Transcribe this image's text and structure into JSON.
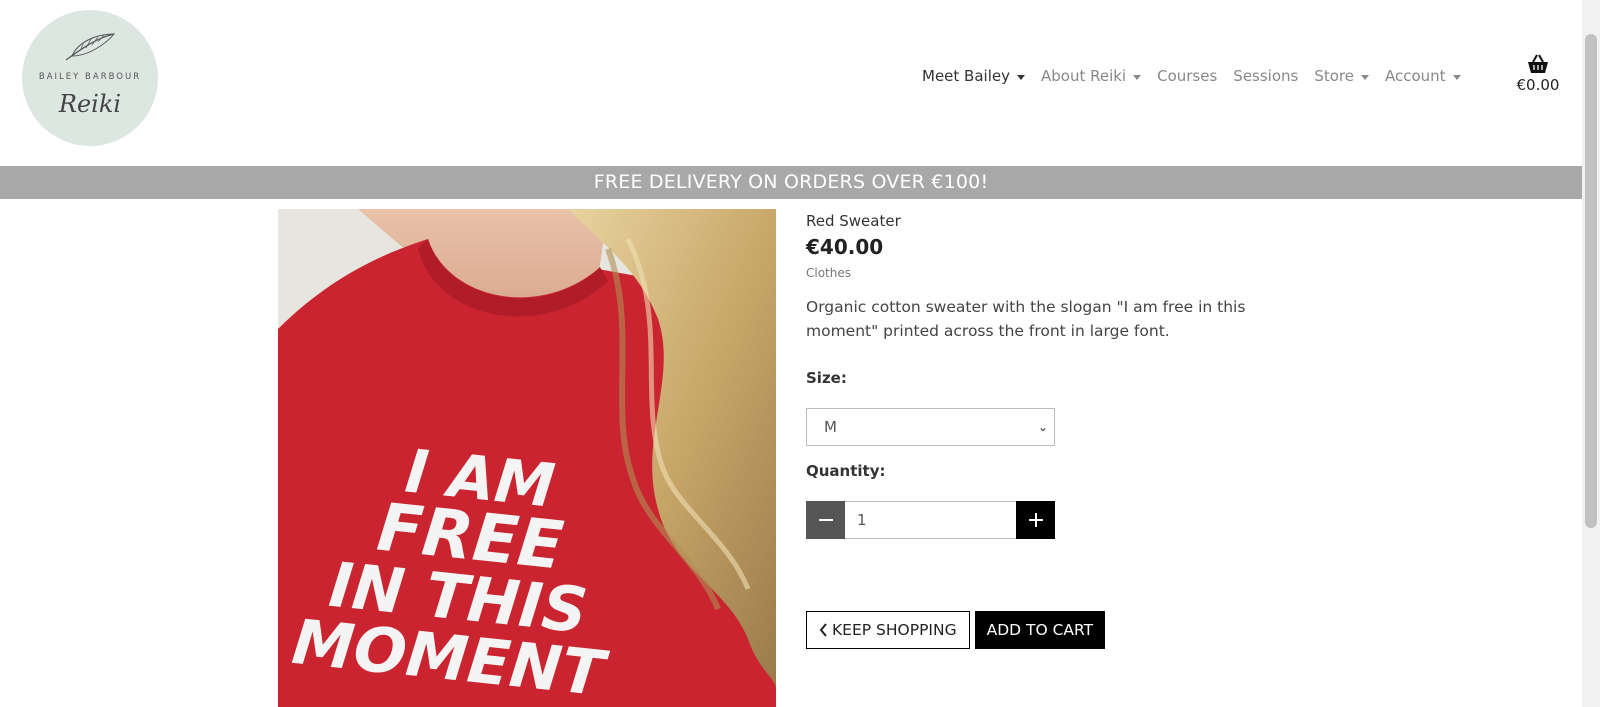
{
  "logo": {
    "top_text": "BAILEY BARBOUR",
    "script_text": "Reiki"
  },
  "nav": {
    "items": [
      {
        "label": "Meet Bailey",
        "dropdown": true
      },
      {
        "label": "About Reiki",
        "dropdown": true
      },
      {
        "label": "Courses",
        "dropdown": false
      },
      {
        "label": "Sessions",
        "dropdown": false
      },
      {
        "label": "Store",
        "dropdown": true
      },
      {
        "label": "Account",
        "dropdown": true
      }
    ]
  },
  "cart": {
    "icon": "basket-icon",
    "total": "€0.00"
  },
  "banner": {
    "text": "FREE DELIVERY ON ORDERS OVER €100!"
  },
  "product": {
    "image_slogan": [
      "I AM",
      "FREE",
      "IN THIS",
      "MOMENT"
    ],
    "name": "Red Sweater",
    "price": "€40.00",
    "category": "Clothes",
    "description": "Organic cotton sweater with the slogan \"I am free in this moment\" printed across the front in large font.",
    "size_label": "Size:",
    "size_value": "M",
    "quantity_label": "Quantity:",
    "quantity_value": "1"
  },
  "buttons": {
    "keep_shopping": "KEEP SHOPPING",
    "add_to_cart": "ADD TO CART"
  },
  "colors": {
    "banner_bg": "#a8a8a8",
    "sweater_red": "#c9242f",
    "logo_bg": "#dde7e1"
  }
}
